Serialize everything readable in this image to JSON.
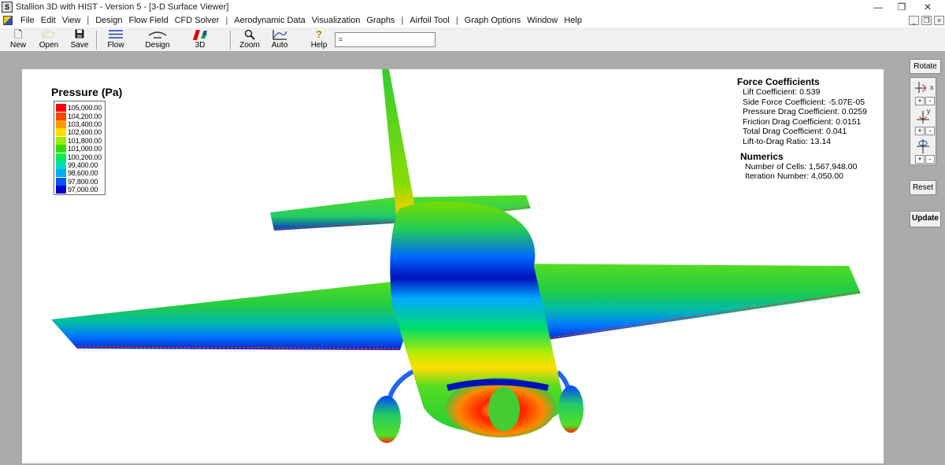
{
  "window": {
    "title": "Stallion 3D with HIST - Version 5 - [3-D Surface Viewer]",
    "minimize": "—",
    "restore": "❐",
    "close": "✕"
  },
  "menu": {
    "items": [
      "File",
      "Edit",
      "View",
      "|",
      "Design",
      "Flow Field",
      "CFD Solver",
      "|",
      "Aerodynamic Data",
      "Visualization",
      "Graphs",
      "|",
      "Airfoil Tool",
      "|",
      "Graph Options",
      "Window",
      "Help"
    ],
    "mdi_min": "_",
    "mdi_restore": "❐",
    "mdi_close": "×"
  },
  "toolbar": {
    "new": "New",
    "open": "Open",
    "save": "Save",
    "flow": "Flow",
    "design": "Design",
    "threed": "3D",
    "zoom": "Zoom",
    "auto": "Auto",
    "help": "Help"
  },
  "legend": {
    "title": "Pressure (Pa)",
    "entries": [
      {
        "label": "105,000.00",
        "color": "#ff0000"
      },
      {
        "label": "104,200.00",
        "color": "#ff4400"
      },
      {
        "label": "103,400.00",
        "color": "#ff9900"
      },
      {
        "label": "102,600.00",
        "color": "#ffdd00"
      },
      {
        "label": "101,800.00",
        "color": "#99ee00"
      },
      {
        "label": "101,000.00",
        "color": "#33dd00"
      },
      {
        "label": "100,200.00",
        "color": "#00ee55"
      },
      {
        "label": "99,400.00",
        "color": "#00ddbb"
      },
      {
        "label": "98,600.00",
        "color": "#00aaff"
      },
      {
        "label": "97,800.00",
        "color": "#0055ff"
      },
      {
        "label": "97,000.00",
        "color": "#0000cc"
      }
    ]
  },
  "force_coefficients": {
    "title": "Force Coefficients",
    "lift": "Lift Coefficient: 0.539",
    "side": "Side Force Coefficient: -5.07E-05",
    "pressure_drag": "Pressure Drag Coefficient: 0.0259",
    "friction_drag": "Friction Drag Coefficient: 0.0151",
    "total_drag": "Total Drag Coefficient: 0.041",
    "ld_ratio": "Lift-to-Drag Ratio: 13.14"
  },
  "numerics": {
    "title": "Numerics",
    "cells": "Number of Cells: 1,567,948.00",
    "iteration": "Iteration Number: 4,050.00"
  },
  "right_panel": {
    "rotate": "Rotate",
    "axis_x": "x",
    "axis_y": "y",
    "plus": "+",
    "minus": "-",
    "reset": "Reset",
    "update": "Update"
  }
}
